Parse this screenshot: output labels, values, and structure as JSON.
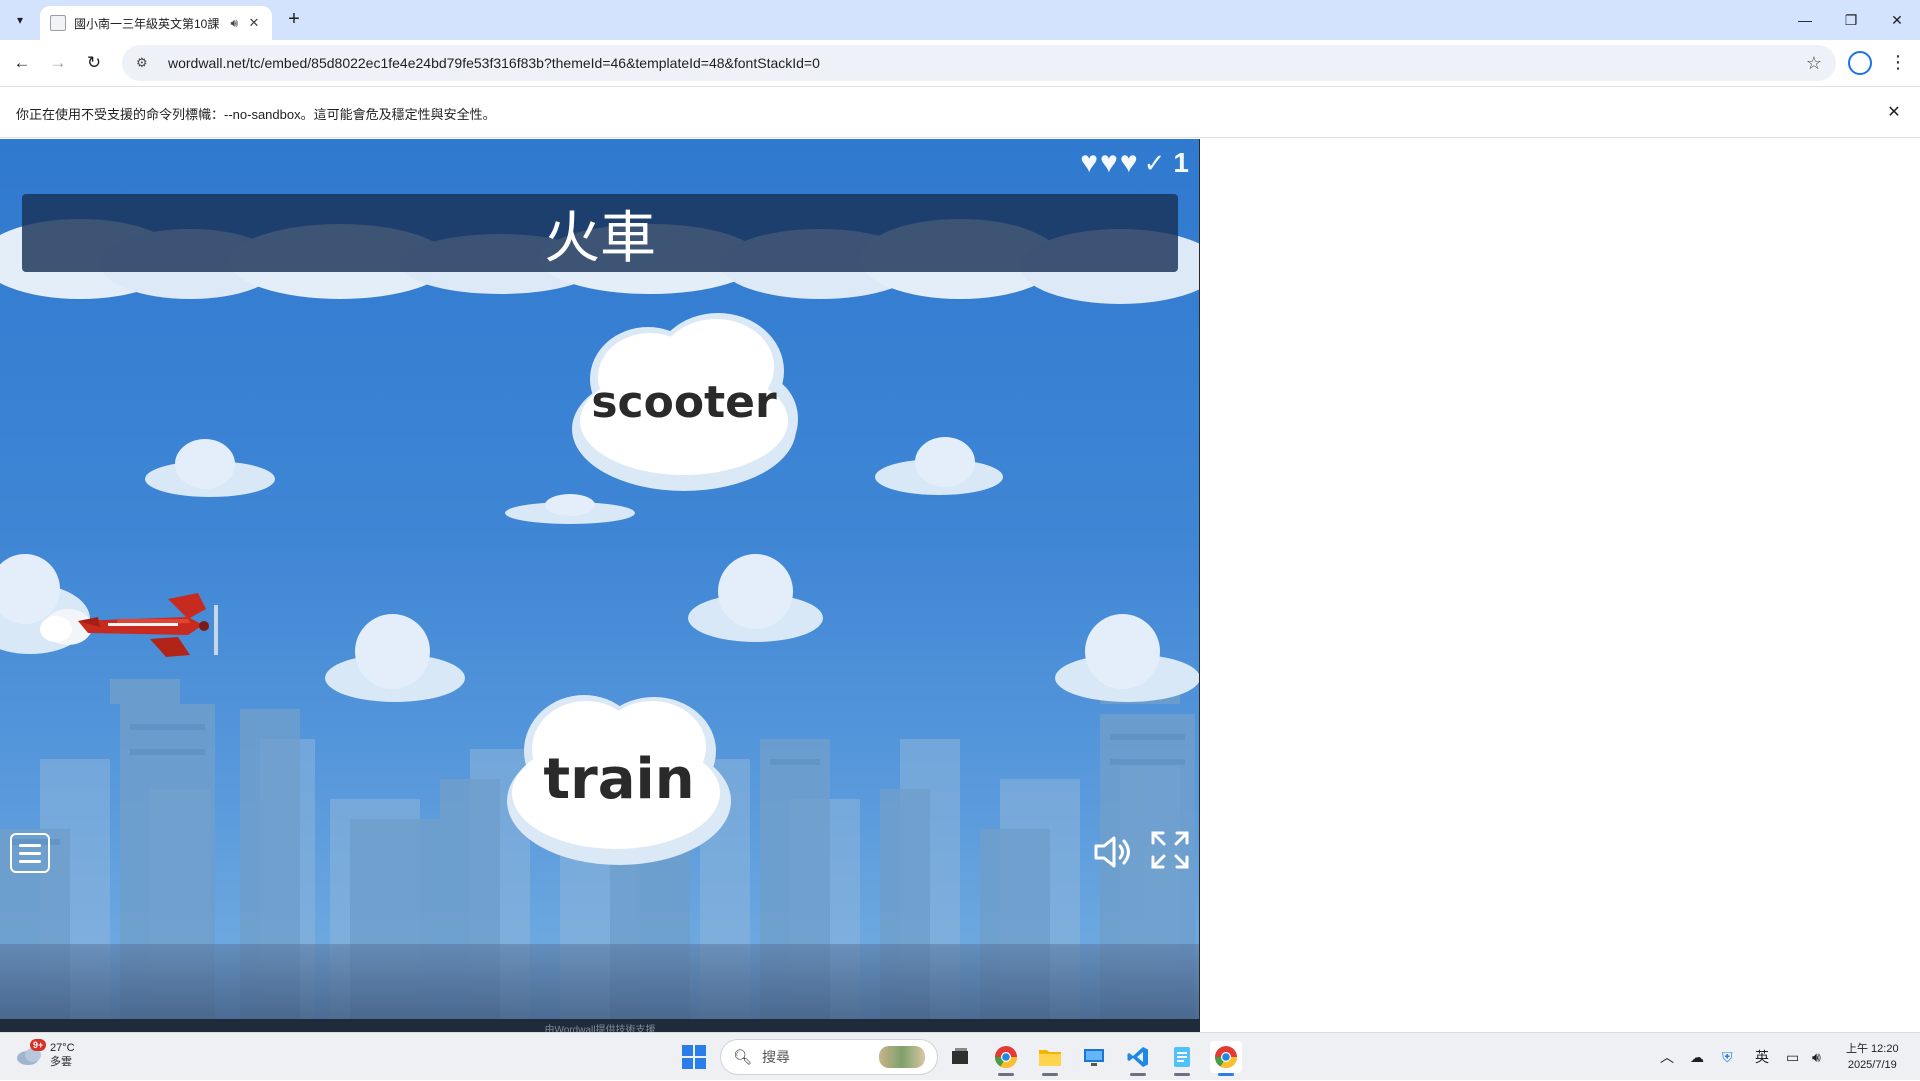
{
  "browser": {
    "tab_title": "國小南一三年級英文第10課",
    "tab_close": "✕",
    "new_tab": "+",
    "url": "wordwall.net/tc/embed/85d8022ec1fe4e24bd79fe53f316f83b?themeId=46&templateId=48&fontStackId=0",
    "infobar_text": "你正在使用不受支援的命令列標幟：--no-sandbox。這可能會危及穩定性與安全性。",
    "infobar_close": "✕"
  },
  "game": {
    "lives": 3,
    "score": "1",
    "check_mark": "✓",
    "question": "火車",
    "answers": [
      "scooter",
      "train"
    ],
    "credit": "由Wordwall提供技術支援"
  },
  "taskbar": {
    "weather_badge": "9+",
    "weather_temp": "27°C",
    "weather_desc": "多雲",
    "search_placeholder": "搜尋",
    "ime": "英",
    "time": "上午 12:20",
    "date": "2025/7/19"
  },
  "colors": {
    "sky_top": "#2f79cf",
    "plane": "#c72a1e",
    "accent_blue": "#2b7de9"
  }
}
